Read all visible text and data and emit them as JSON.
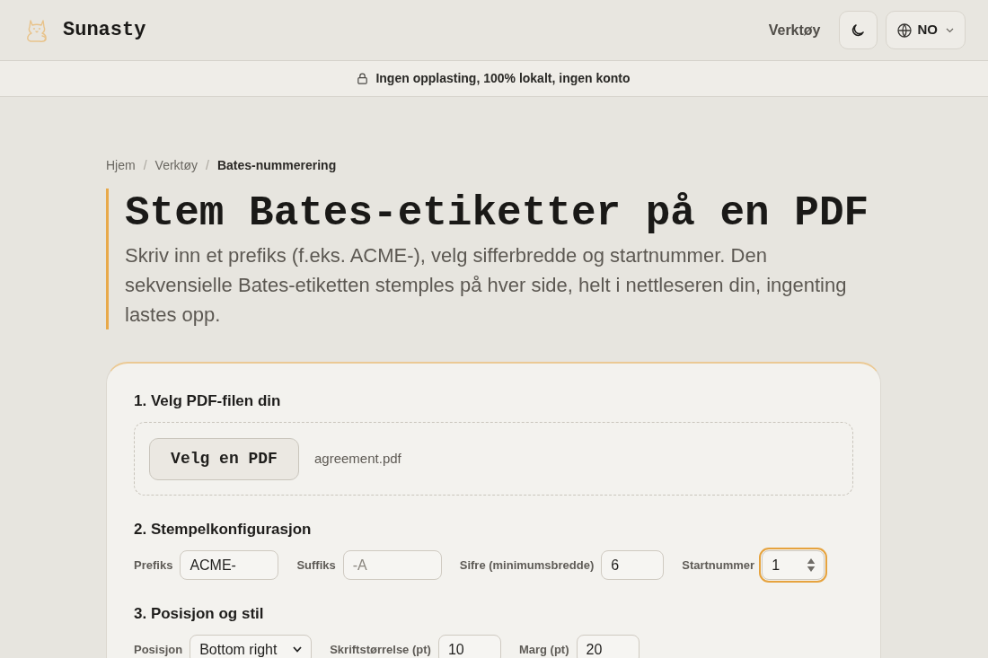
{
  "header": {
    "brand": "Sunasty",
    "nav_link": "Verktøy",
    "language": "NO"
  },
  "banner": {
    "text": "Ingen opplasting, 100% lokalt, ingen konto"
  },
  "breadcrumb": [
    {
      "kind": "link",
      "label": "Hjem"
    },
    {
      "kind": "separator",
      "label": "/"
    },
    {
      "kind": "link",
      "label": "Verktøy"
    },
    {
      "kind": "separator",
      "label": "/"
    },
    {
      "kind": "current",
      "label": "Bates-nummerering"
    }
  ],
  "title": "Stem Bates-etiketter på en PDF",
  "description": "Skriv inn et prefiks (f.eks. ACME-), velg sifferbredde og startnummer. Den sekvensielle Bates-etiketten stemples på hver side, helt i nettleseren din, ingenting lastes opp.",
  "sections": [
    {
      "kind": "file",
      "heading": "1. Velg PDF-filen din",
      "button": "Velg en PDF",
      "file_name": "agreement.pdf"
    },
    {
      "kind": "fields",
      "heading": "2. Stempelkonfigurasjon",
      "fields": [
        {
          "kind": "text",
          "label": "Prefiks",
          "value": "ACME-",
          "focused": false
        },
        {
          "kind": "text",
          "label": "Suffiks",
          "placeholder": "-A",
          "focused": false
        },
        {
          "kind": "number",
          "label": "Sifre (minimumsbredde)",
          "value": "6",
          "focused": false
        },
        {
          "kind": "number",
          "label": "Startnummer",
          "value": "1",
          "focused": true
        }
      ]
    },
    {
      "kind": "fields",
      "heading": "3. Posisjon og stil",
      "fields": [
        {
          "kind": "select",
          "label": "Posisjon",
          "value": "Bottom right",
          "focused": false
        },
        {
          "kind": "number",
          "label": "Skriftstørrelse (pt)",
          "value": "10",
          "focused": false
        },
        {
          "kind": "number",
          "label": "Marg (pt)",
          "value": "20",
          "focused": false
        }
      ]
    }
  ]
}
